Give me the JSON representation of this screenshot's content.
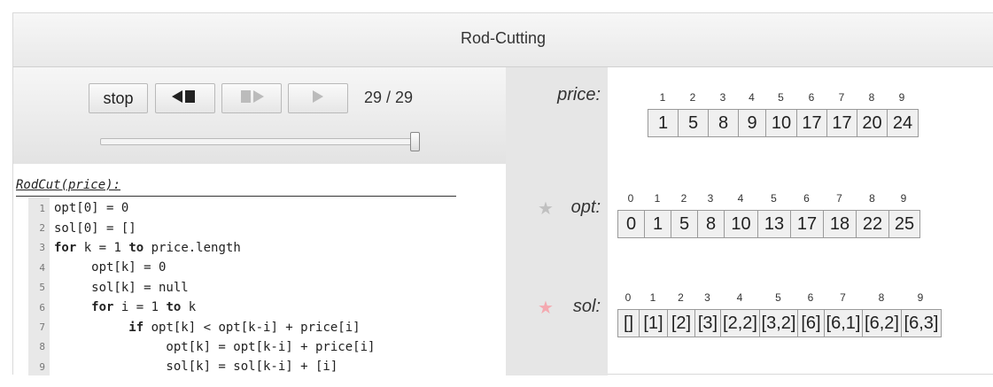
{
  "title": "Rod-Cutting",
  "controls": {
    "stop_label": "stop",
    "back_icon": "step-back-icon",
    "forward_icon": "step-forward-icon",
    "play_icon": "play-icon",
    "counter": "29 / 29",
    "progress": 1.0
  },
  "code": {
    "signature": "RodCut(price):",
    "lines": [
      {
        "num": "1",
        "text": "opt[0] = 0"
      },
      {
        "num": "2",
        "text": "sol[0] = []"
      },
      {
        "num": "3",
        "text": "for k = 1 to price.length"
      },
      {
        "num": "4",
        "text": "     opt[k] = 0"
      },
      {
        "num": "5",
        "text": "     sol[k] = null"
      },
      {
        "num": "6",
        "text": "     for i = 1 to k"
      },
      {
        "num": "7",
        "text": "          if opt[k] < opt[k-i] + price[i]"
      },
      {
        "num": "8",
        "text": "               opt[k] = opt[k-i] + price[i]"
      },
      {
        "num": "9",
        "text": "               sol[k] = sol[k-i] + [i]"
      }
    ]
  },
  "variables": {
    "price": {
      "label": "price:",
      "indices": [
        "1",
        "2",
        "3",
        "4",
        "5",
        "6",
        "7",
        "8",
        "9"
      ],
      "values": [
        "1",
        "5",
        "8",
        "9",
        "10",
        "17",
        "17",
        "20",
        "24"
      ]
    },
    "opt": {
      "label": "opt:",
      "star": "star-icon",
      "star_color": "#c0c0c0",
      "indices": [
        "0",
        "1",
        "2",
        "3",
        "4",
        "5",
        "6",
        "7",
        "8",
        "9"
      ],
      "values": [
        "0",
        "1",
        "5",
        "8",
        "10",
        "13",
        "17",
        "18",
        "22",
        "25"
      ]
    },
    "sol": {
      "label": "sol:",
      "star": "star-icon",
      "star_color": "#f4a9b0",
      "indices": [
        "0",
        "1",
        "2",
        "3",
        "4",
        "5",
        "6",
        "7",
        "8",
        "9"
      ],
      "values": [
        "[]",
        "[1]",
        "[2]",
        "[3]",
        "[2,2]",
        "[3,2]",
        "[6]",
        "[6,1]",
        "[6,2]",
        "[6,3]"
      ]
    }
  }
}
